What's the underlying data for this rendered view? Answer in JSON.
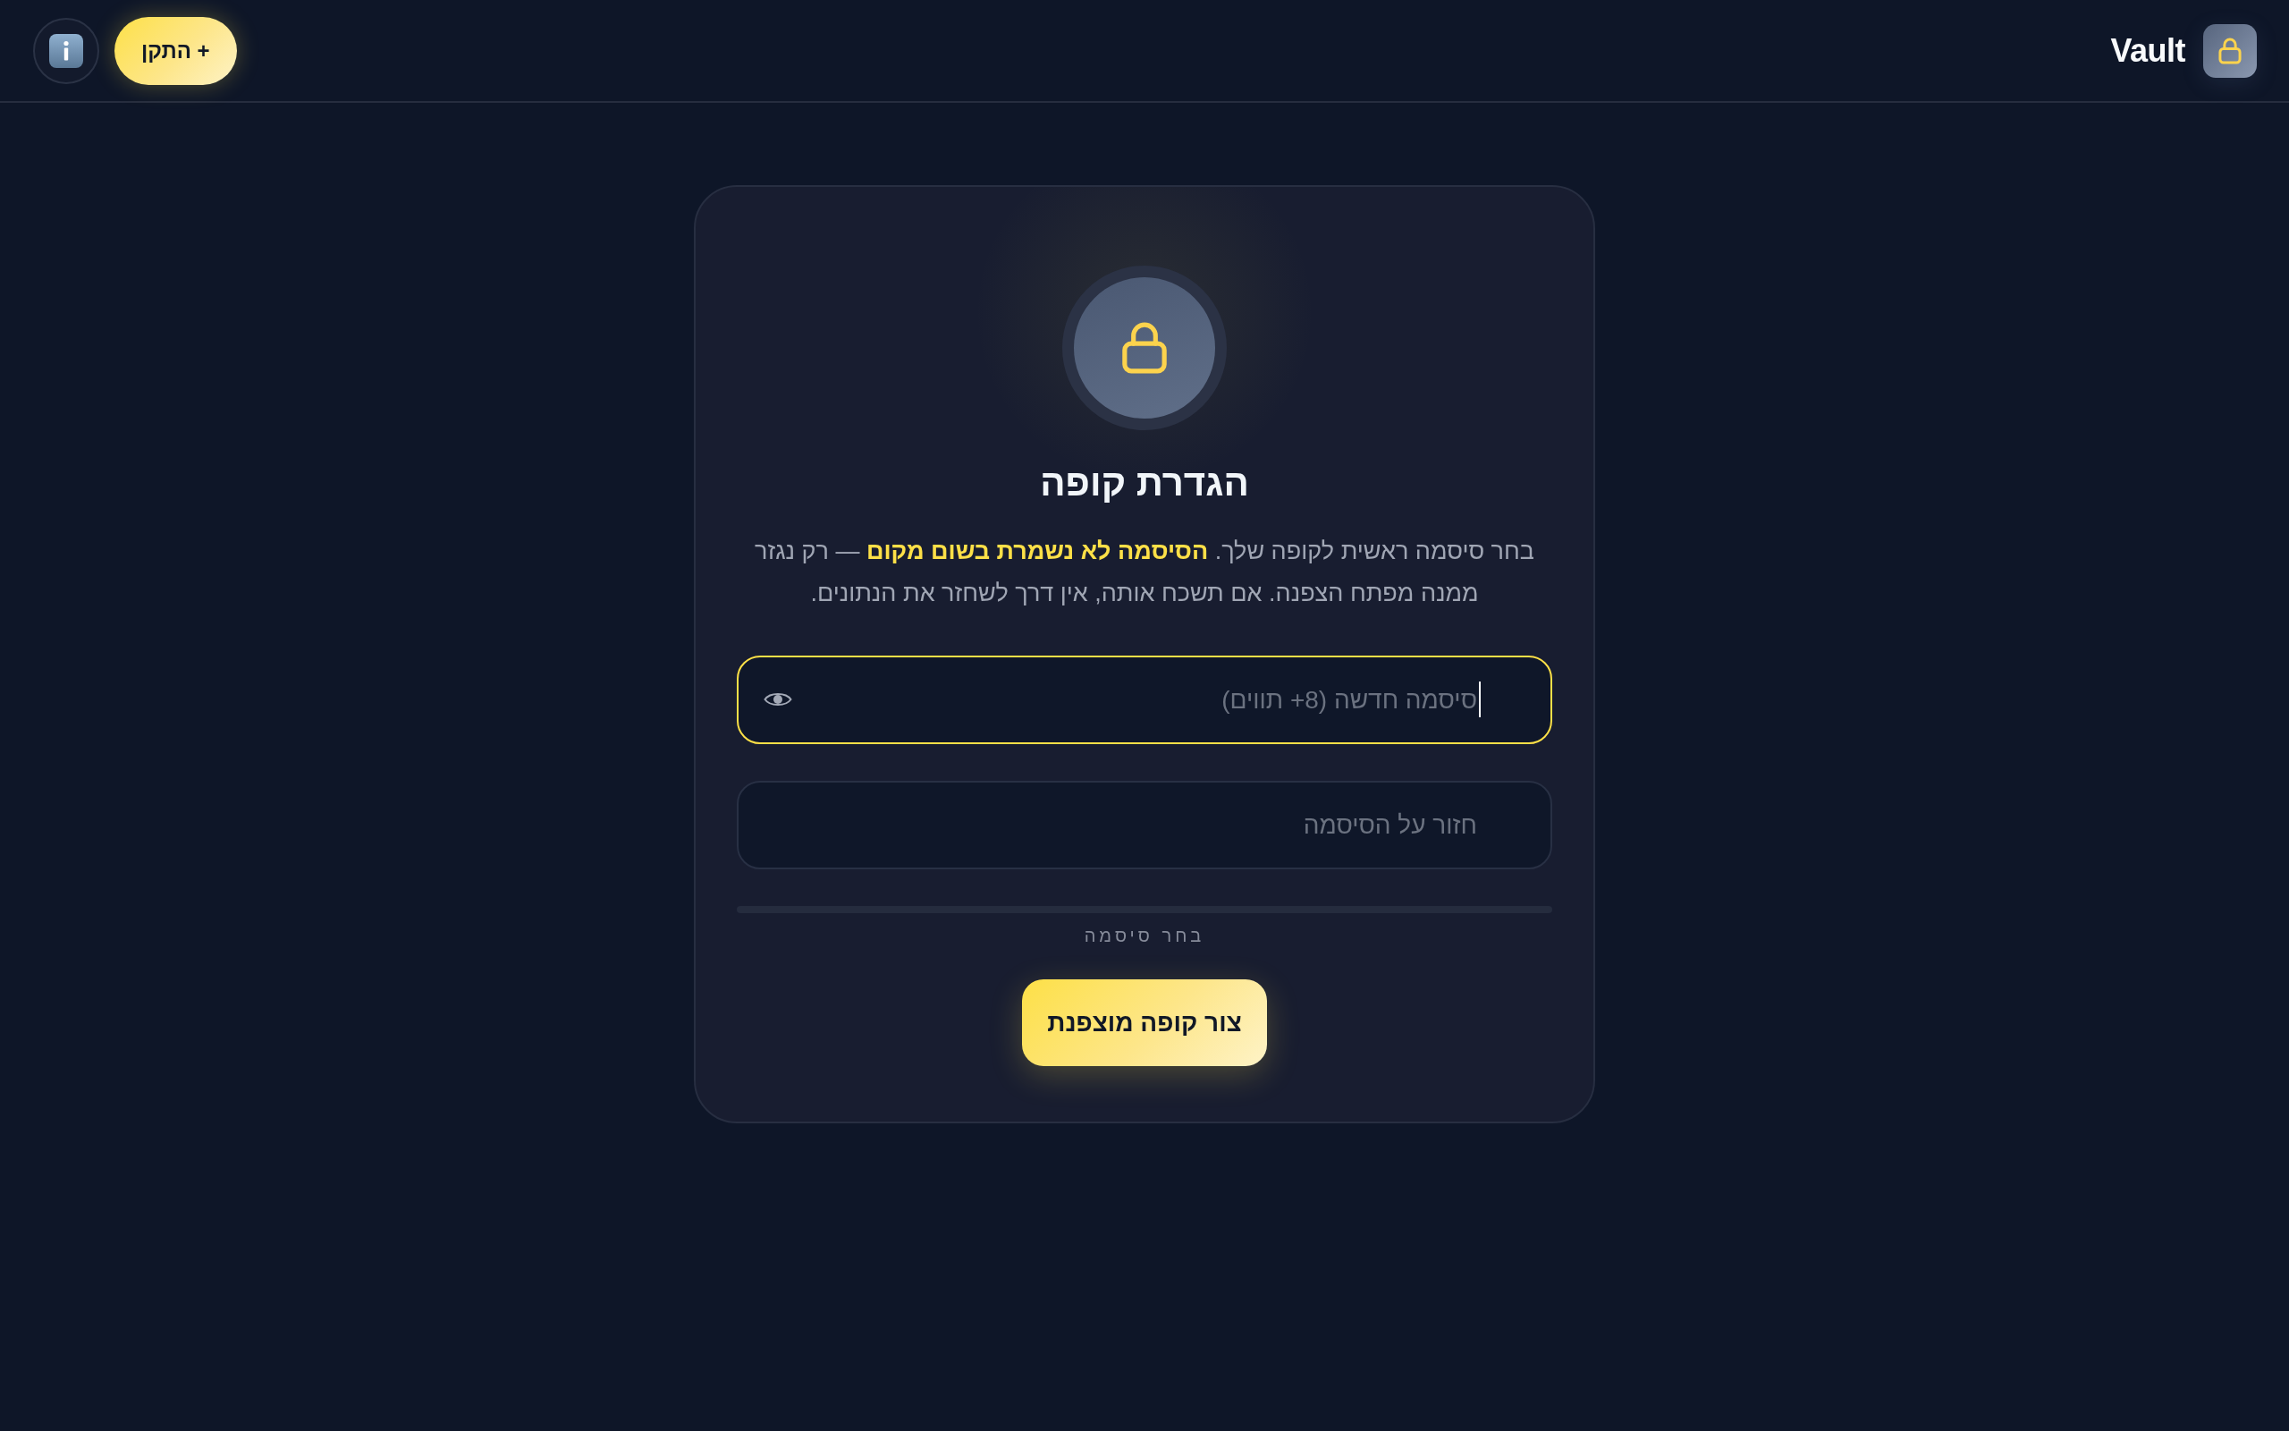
{
  "header": {
    "title": "Vault",
    "install_button": {
      "label": "+ התקן"
    }
  },
  "setup_card": {
    "title": "הגדרת קופה",
    "description": "בחר סיסמה ראשית לקופה שלך. **הסיסמה לא נשמרת בשום מקום** — רק נגזר ממנה מפתח הצפנה. אם תשכח אותה, אין דרך לשחזר את הנתונים.",
    "fields": [
      {
        "placeholder": "סיסמה חדשה (8+ תווים)",
        "focused": true,
        "show_toggle": true
      },
      {
        "placeholder": "חזור על הסיסמה",
        "focused": false,
        "show_toggle": false
      }
    ],
    "strength": {
      "level": 0,
      "label": "בחר סיסמה"
    },
    "submit_button": {
      "label": "צור קופה מוצפנת"
    }
  }
}
